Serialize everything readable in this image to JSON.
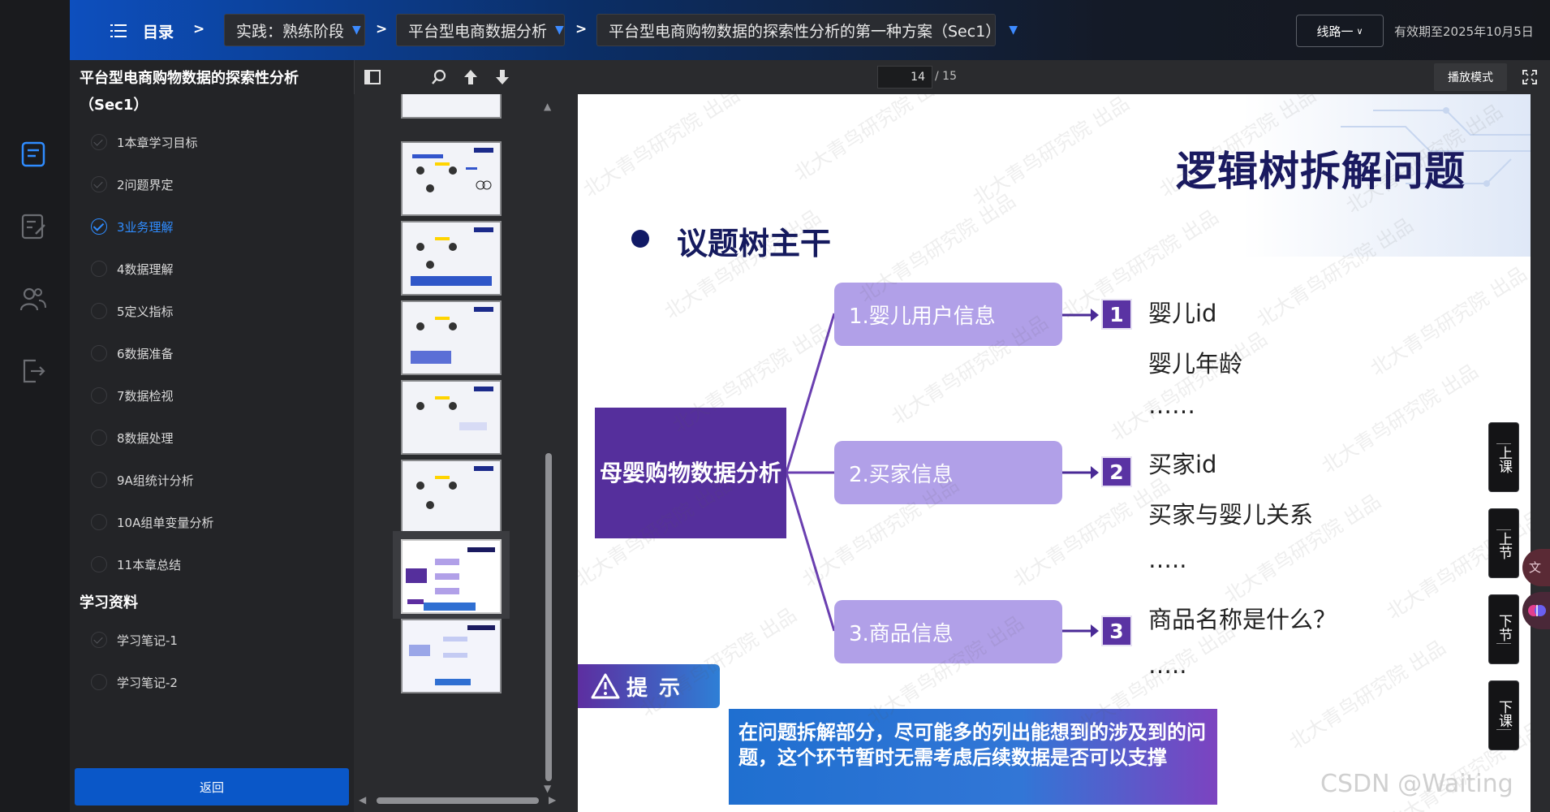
{
  "header": {
    "toc_label": "目录",
    "separator": ">",
    "crumbs": [
      "实践：熟练阶段",
      "平台型电商数据分析",
      "平台型电商购物数据的探索性分析的第一种方案（Sec1）"
    ],
    "route_label": "线路一",
    "expire_text": "有效期至2025年10月5日"
  },
  "course": {
    "title": "平台型电商购物数据的探索性分析（Sec1）",
    "chapters": [
      {
        "label": "1本章学习目标",
        "state": "done"
      },
      {
        "label": "2问题界定",
        "state": "done"
      },
      {
        "label": "3业务理解",
        "state": "active"
      },
      {
        "label": "4数据理解",
        "state": "todo"
      },
      {
        "label": "5定义指标",
        "state": "todo"
      },
      {
        "label": "6数据准备",
        "state": "todo"
      },
      {
        "label": "7数据检视",
        "state": "todo"
      },
      {
        "label": "8数据处理",
        "state": "todo"
      },
      {
        "label": "9A组统计分析",
        "state": "todo"
      },
      {
        "label": "10A组单变量分析",
        "state": "todo"
      },
      {
        "label": "11本章总结",
        "state": "todo"
      }
    ],
    "materials_title": "学习资料",
    "materials": [
      {
        "label": "学习笔记-1",
        "state": "done"
      },
      {
        "label": "学习笔记-2",
        "state": "todo"
      }
    ],
    "back_label": "返回"
  },
  "viewer": {
    "current_page": "14",
    "total_pages": "/ 15",
    "play_mode_label": "播放模式"
  },
  "slide": {
    "title": "逻辑树拆解问题",
    "subtitle": "议题树主干",
    "root": "母婴购物数据分析",
    "branches": [
      {
        "label": "1.婴儿用户信息",
        "num": "1",
        "leaves": [
          "婴儿id",
          "婴儿年龄",
          "……"
        ]
      },
      {
        "label": "2.买家信息",
        "num": "2",
        "leaves": [
          "买家id",
          "买家与婴儿关系",
          "….."
        ]
      },
      {
        "label": "3.商品信息",
        "num": "3",
        "leaves": [
          "商品名称是什么？",
          "….."
        ]
      }
    ],
    "tip_label": "提示",
    "tip_text": "在问题拆解部分，尽可能多的列出能想到的涉及到的问题，这个环节暂时无需考虑后续数据是否可以支撑",
    "watermark": "北大青鸟研究院 出品"
  },
  "side_nav": {
    "prev_lesson": "上课",
    "prev_section": "上节",
    "next_section": "下节",
    "next_lesson": "下课"
  },
  "footer_watermark": "CSDN @Waiting",
  "colors": {
    "accent_blue": "#0a57c8",
    "active_chapter": "#2f8cff",
    "root_purple": "#552f9c",
    "branch_lilac": "#b1a0e8",
    "title_navy": "#1a1a60"
  }
}
